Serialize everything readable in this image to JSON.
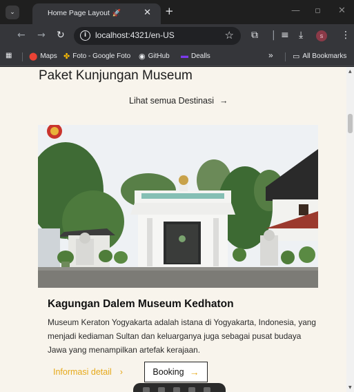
{
  "browser": {
    "tab_title": "Home Page Layout",
    "tab_icon": "rocket-icon",
    "url": "localhost:4321/en-US",
    "profile_initial": "s",
    "bookmarks": [
      {
        "label": "Maps",
        "icon": "maps-pin-icon"
      },
      {
        "label": "Foto - Google Foto",
        "icon": "pinwheel-icon"
      },
      {
        "label": "GitHub",
        "icon": "github-icon"
      },
      {
        "label": "Dealls",
        "icon": "dealls-icon"
      }
    ],
    "overflow_label": "»",
    "all_bookmarks": "All Bookmarks"
  },
  "page": {
    "section_title": "Paket Kunjungan Museum",
    "see_all": "Lihat semua Destinasi",
    "arrow": "→",
    "card": {
      "title": "Kagungan Dalem Museum Kedhaton",
      "description": "Museum Keraton Yogyakarta adalah istana di Yogyakarta, Indonesia, yang menjadi kediaman Sultan dan keluarganya juga sebagai pusat budaya Jawa yang menampilkan artefak kerajaan.",
      "detail_label": "Informasi detail",
      "detail_arrow": "›",
      "booking_label": "Booking",
      "booking_arrow": "→",
      "image_icon": "royal-crest-icon"
    }
  },
  "colors": {
    "page_bg": "#f8f4ec",
    "accent": "#e6a91a",
    "chrome_dark": "#1f1f1f",
    "chrome_toolbar": "#35363a"
  }
}
